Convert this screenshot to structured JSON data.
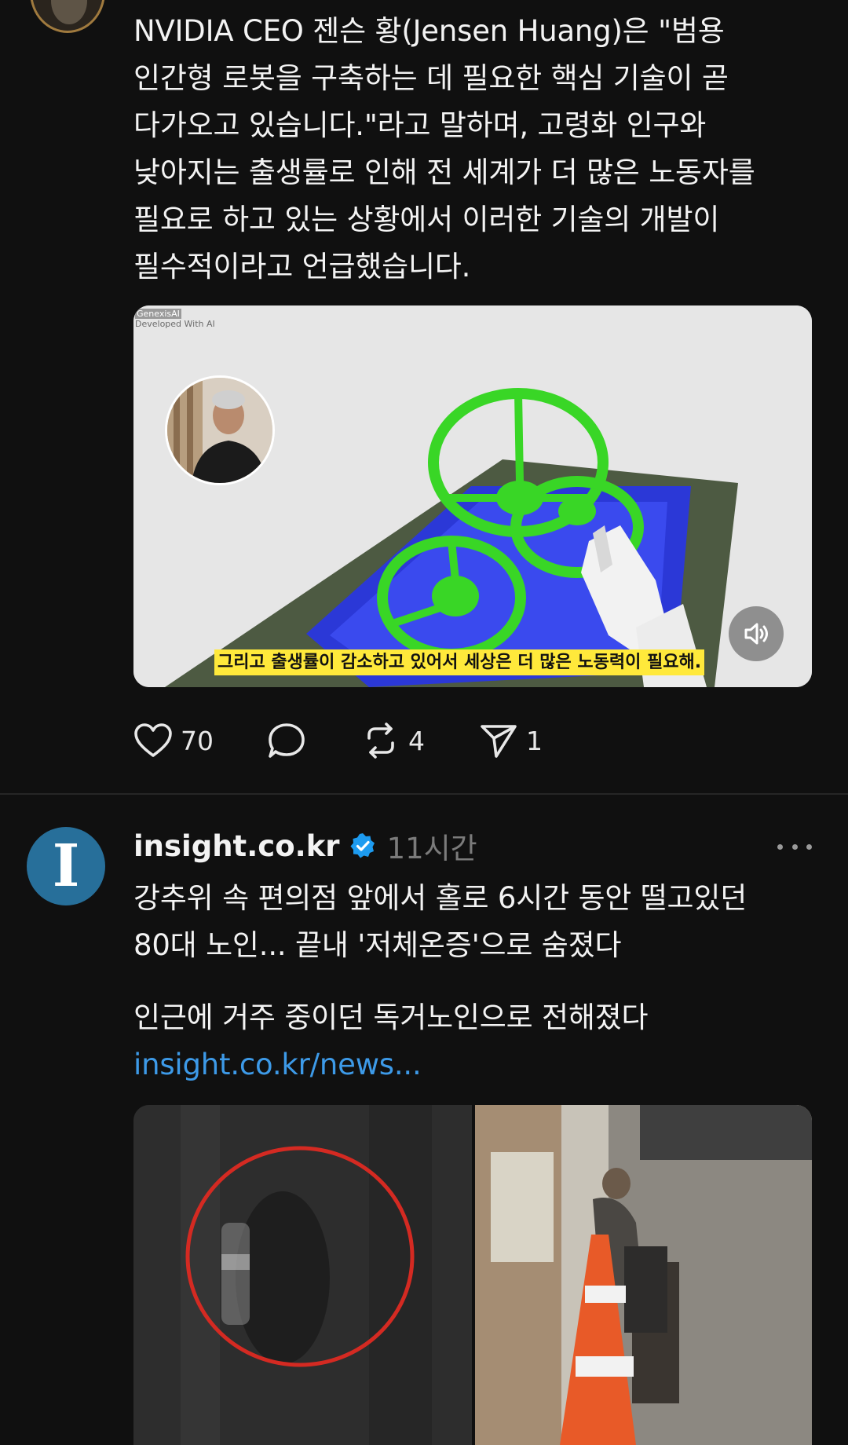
{
  "post1": {
    "text_lines": [
      "NVIDIA CEO 젠슨 황(Jensen Huang)은 \"범용",
      "인간형 로봇을 구축하는 데 필요한 핵심 기술이 곧",
      "다가오고 있습니다.\"라고 말하며, 고령화 인구와",
      "낮아지는 출생률로 인해 전 세계가 더 많은 노동자를",
      "필요로 하고 있는 상황에서 이러한 기술의 개발이",
      "필수적이라고 언급했습니다."
    ],
    "video": {
      "watermark_brand": "GenexisAI",
      "watermark_sub": "Developed With AI",
      "subtitle": "그리고 출생률이 감소하고 있어서 세상은 더 많은 노동력이 필요해."
    },
    "actions": {
      "likes": "70",
      "reposts": "4",
      "shares": "1"
    }
  },
  "post2": {
    "avatar_letter": "I",
    "username": "insight.co.kr",
    "timestamp": "11시간",
    "title_lines": [
      "강추위 속 편의점 앞에서 홀로 6시간 동안 떨고있던",
      "80대 노인... 끝내 '저체온증'으로 숨졌다"
    ],
    "subtitle": "인근에 거주 중이던 독거노인으로 전해졌다",
    "link": "insight.co.kr/news..."
  },
  "colors": {
    "background": "#101010",
    "text": "#f3f3f3",
    "muted": "#7b7b7b",
    "link": "#3d9ae8",
    "verified": "#1d9bf0",
    "caption_bg": "#ffe93b",
    "avatar_blue": "#276f9a"
  },
  "icons": [
    "heart-icon",
    "comment-icon",
    "repost-icon",
    "send-icon",
    "verified-icon",
    "volume-icon",
    "more-icon"
  ]
}
